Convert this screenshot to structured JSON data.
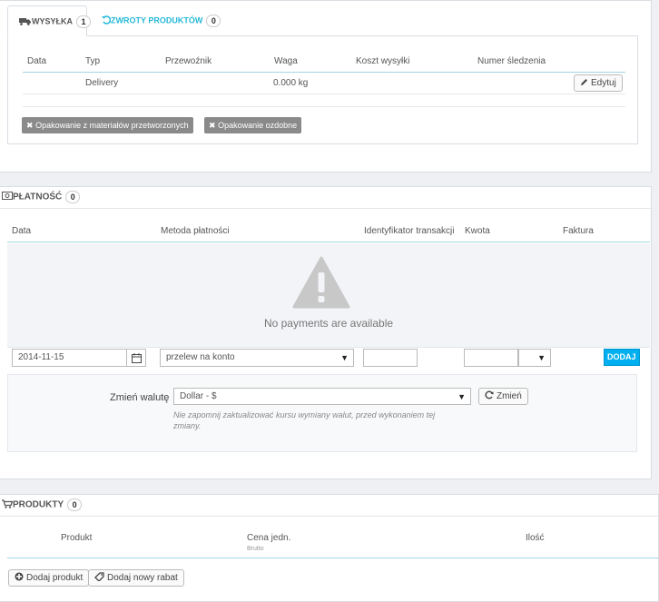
{
  "shipping": {
    "tab_active_label": "Wysyłka",
    "tab_active_count": "1",
    "tab_inactive_label": "Zwroty produktów",
    "tab_inactive_count": "0",
    "columns": [
      "Data",
      "Typ",
      "Przewoźnik",
      "Waga",
      "Koszt wysyłki",
      "Numer śledzenia"
    ],
    "row": {
      "date": "",
      "type": "Delivery",
      "carrier": "",
      "weight": "0.000 kg",
      "cost": "",
      "tracking": ""
    },
    "edit_label": "Edytuj",
    "tags": [
      "Opakowanie z materiałów przetworzonych",
      "Opakowanie ozdobne"
    ]
  },
  "payment": {
    "title": "Płatność",
    "count": "0",
    "columns": [
      "Data",
      "Metoda płatności",
      "Identyfikator transakcji",
      "Kwota",
      "Faktura"
    ],
    "empty_message": "No payments are available",
    "date_value": "2014-11-15",
    "method_value": "przelew na konto",
    "transaction_value": "",
    "amount_value": "",
    "add_label": "DODAJ",
    "currency_label": "Zmień walutę",
    "currency_value": "Dollar - $",
    "change_label": "Zmień",
    "currency_note": "Nie zapomnij zaktualizować kursu wymiany walut, przed wykonaniem tej zmiany."
  },
  "products": {
    "title": "Produkty",
    "count": "0",
    "col_product": "Produkt",
    "col_price": "Cena jedn.",
    "col_price_sub": "Brutto",
    "col_qty": "Ilość",
    "add_product_label": "Dodaj produkt",
    "add_discount_label": "Dodaj nowy rabat"
  },
  "colors": {
    "accent": "#25b9d7",
    "primary_button": "#00aff0",
    "tag_bg": "#8a8a8a"
  }
}
